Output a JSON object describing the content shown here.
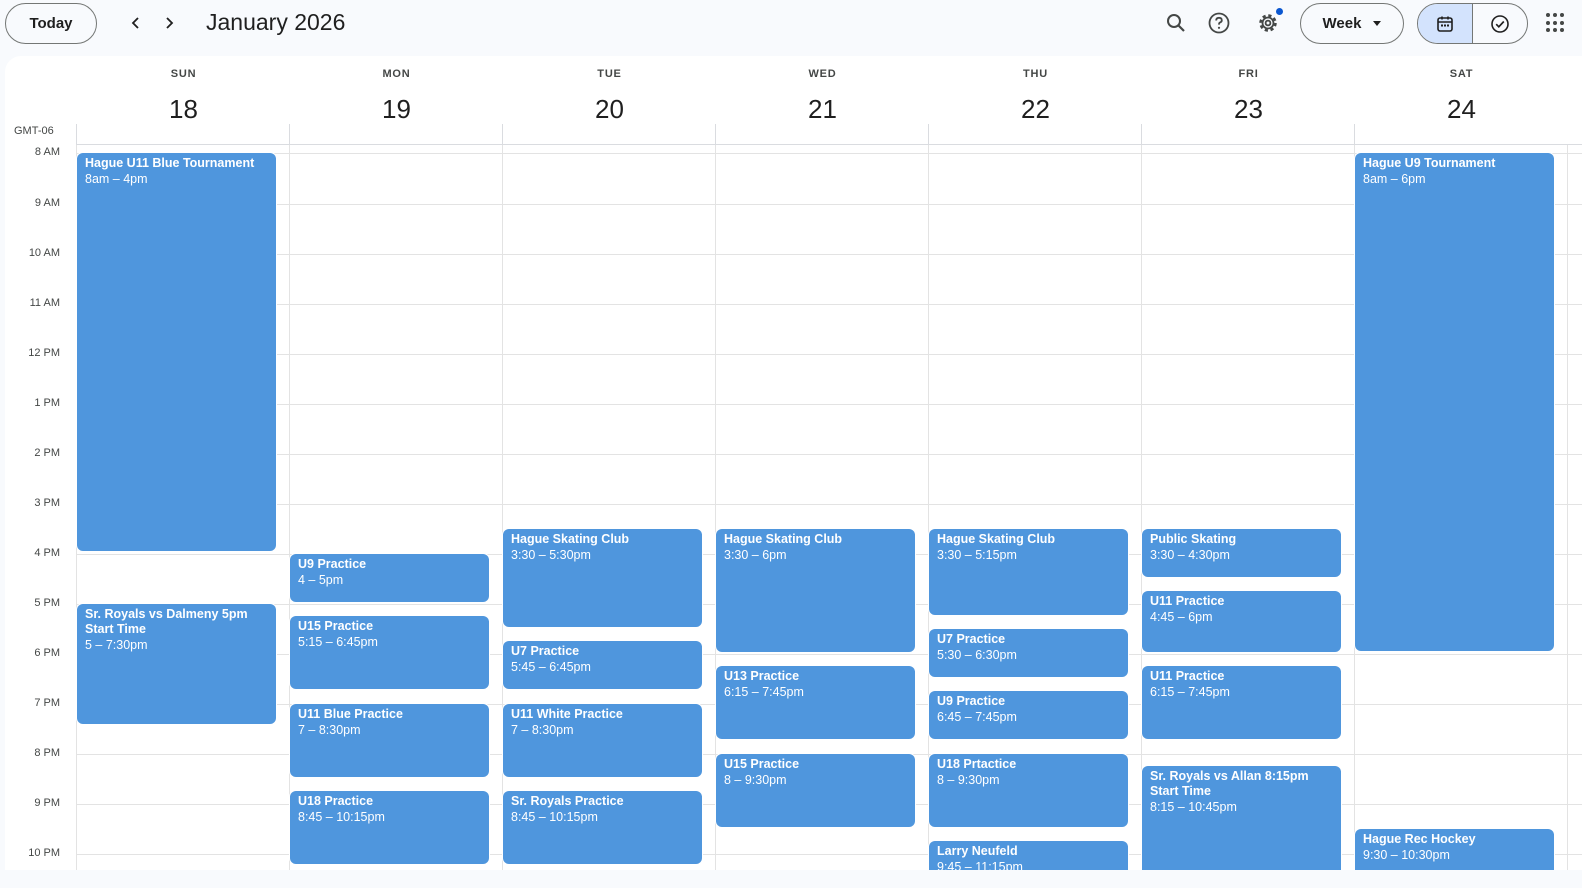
{
  "header": {
    "today_label": "Today",
    "month_title": "January 2026",
    "view_label": "Week",
    "icons": [
      "chevron-left-icon",
      "chevron-right-icon",
      "search-icon",
      "help-icon",
      "settings-icon",
      "calendar-icon",
      "tasks-icon",
      "apps-grid-icon"
    ]
  },
  "timezone": "GMT-06",
  "days": [
    {
      "name": "SUN",
      "num": "18"
    },
    {
      "name": "MON",
      "num": "19"
    },
    {
      "name": "TUE",
      "num": "20"
    },
    {
      "name": "WED",
      "num": "21"
    },
    {
      "name": "THU",
      "num": "22"
    },
    {
      "name": "FRI",
      "num": "23"
    },
    {
      "name": "SAT",
      "num": "24"
    }
  ],
  "hours": [
    "8 AM",
    "9 AM",
    "10 AM",
    "11 AM",
    "12 PM",
    "1 PM",
    "2 PM",
    "3 PM",
    "4 PM",
    "5 PM",
    "6 PM",
    "7 PM",
    "8 PM",
    "9 PM",
    "10 PM"
  ],
  "events": [
    {
      "day": 0,
      "title": "Hague U11 Blue Tournament",
      "time": "8am – 4pm",
      "start": 8.0,
      "end": 16.0
    },
    {
      "day": 0,
      "title": "Sr. Royals vs Dalmeny 5pm Start Time",
      "time": "5 – 7:30pm",
      "start": 17.0,
      "end": 19.45
    },
    {
      "day": 1,
      "title": "U9 Practice",
      "time": "4 – 5pm",
      "start": 16.0,
      "end": 17.0
    },
    {
      "day": 1,
      "title": "U15 Practice",
      "time": "5:15 – 6:45pm",
      "start": 17.25,
      "end": 18.75
    },
    {
      "day": 1,
      "title": "U11 Blue Practice",
      "time": "7 – 8:30pm",
      "start": 19.0,
      "end": 20.5
    },
    {
      "day": 1,
      "title": "U18 Practice",
      "time": "8:45 – 10:15pm",
      "start": 20.75,
      "end": 22.25
    },
    {
      "day": 2,
      "title": "Hague Skating Club",
      "time": "3:30 – 5:30pm",
      "start": 15.5,
      "end": 17.5
    },
    {
      "day": 2,
      "title": "U7 Practice",
      "time": "5:45 – 6:45pm",
      "start": 17.75,
      "end": 18.75
    },
    {
      "day": 2,
      "title": "U11 White Practice",
      "time": "7 – 8:30pm",
      "start": 19.0,
      "end": 20.5
    },
    {
      "day": 2,
      "title": "Sr. Royals Practice",
      "time": "8:45 – 10:15pm",
      "start": 20.75,
      "end": 22.25
    },
    {
      "day": 3,
      "title": "Hague Skating Club",
      "time": "3:30 – 6pm",
      "start": 15.5,
      "end": 18.0
    },
    {
      "day": 3,
      "title": "U13 Practice",
      "time": "6:15 – 7:45pm",
      "start": 18.25,
      "end": 19.75
    },
    {
      "day": 3,
      "title": "U15 Practice",
      "time": "8 – 9:30pm",
      "start": 20.0,
      "end": 21.5
    },
    {
      "day": 4,
      "title": "Hague Skating Club",
      "time": "3:30 – 5:15pm",
      "start": 15.5,
      "end": 17.25
    },
    {
      "day": 4,
      "title": "U7 Practice",
      "time": "5:30 – 6:30pm",
      "start": 17.5,
      "end": 18.5
    },
    {
      "day": 4,
      "title": "U9 Practice",
      "time": "6:45 – 7:45pm",
      "start": 18.75,
      "end": 19.75
    },
    {
      "day": 4,
      "title": "U18 Prtactice",
      "time": "8 – 9:30pm",
      "start": 20.0,
      "end": 21.5
    },
    {
      "day": 4,
      "title": "Larry Neufeld",
      "time": "9:45 – 11:15pm",
      "start": 21.75,
      "end": 23.25
    },
    {
      "day": 5,
      "title": "Public Skating",
      "time": "3:30 – 4:30pm",
      "start": 15.5,
      "end": 16.5
    },
    {
      "day": 5,
      "title": "U11 Practice",
      "time": "4:45 – 6pm",
      "start": 16.75,
      "end": 18.0
    },
    {
      "day": 5,
      "title": "U11 Practice",
      "time": "6:15 – 7:45pm",
      "start": 18.25,
      "end": 19.75
    },
    {
      "day": 5,
      "title": "Sr. Royals vs Allan 8:15pm Start Time",
      "time": "8:15 – 10:45pm",
      "start": 20.25,
      "end": 22.75
    },
    {
      "day": 6,
      "title": "Hague U9 Tournament",
      "time": "8am – 6pm",
      "start": 8.0,
      "end": 18.0
    },
    {
      "day": 6,
      "title": "Hague Rec Hockey",
      "time": "9:30 – 10:30pm",
      "start": 21.5,
      "end": 22.5
    }
  ],
  "colors": {
    "event": "#4f96dd",
    "accent": "#0b57d0",
    "active_toggle": "#d3e3fd"
  }
}
